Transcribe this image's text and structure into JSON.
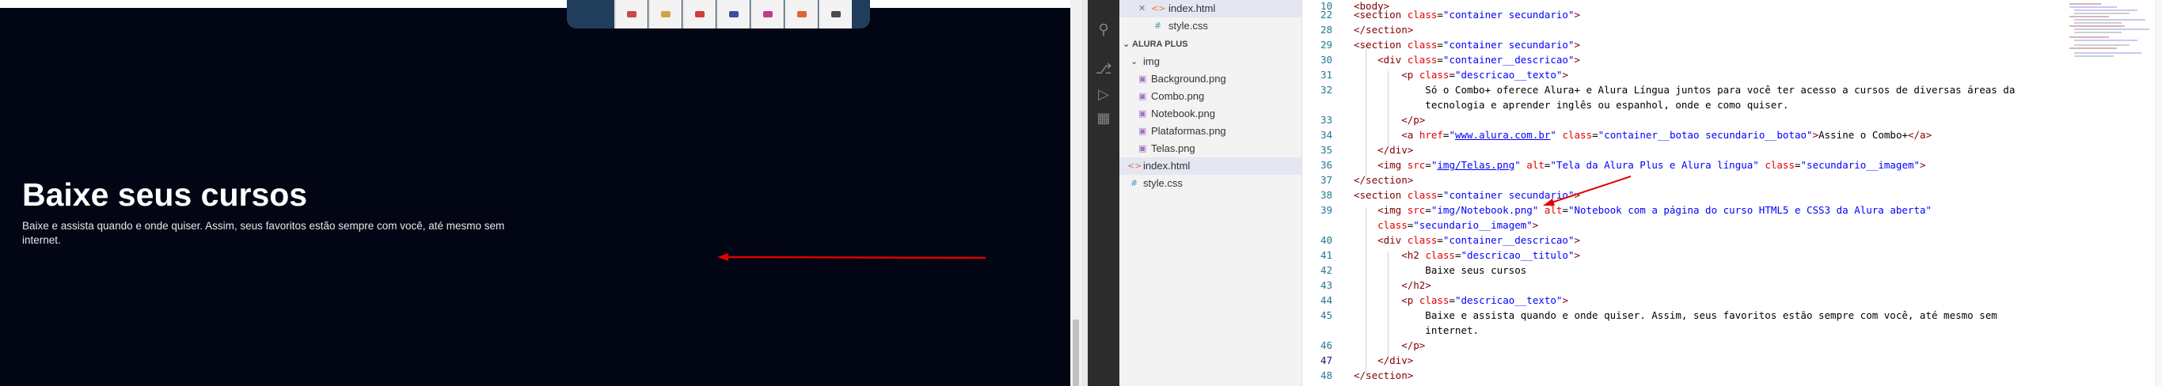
{
  "preview": {
    "heading": "Baixe seus cursos",
    "paragraph": "Baixe e assista quando e onde quiser. Assim, seus favoritos estão sempre com você, até mesmo sem internet."
  },
  "explorer": {
    "items": [
      {
        "label": "index.html",
        "icon": "html-file-icon"
      },
      {
        "label": "style.css",
        "icon": "css-file-icon"
      },
      {
        "label": "ALURA PLUS",
        "icon": "chevron-down-icon"
      },
      {
        "label": "img",
        "icon": "chevron-down-icon"
      },
      {
        "label": "Background.png",
        "icon": "image-file-icon"
      },
      {
        "label": "Combo.png",
        "icon": "image-file-icon"
      },
      {
        "label": "Notebook.png",
        "icon": "image-file-icon"
      },
      {
        "label": "Plataformas.png",
        "icon": "image-file-icon"
      },
      {
        "label": "Telas.png",
        "icon": "image-file-icon"
      },
      {
        "label": "index.html",
        "icon": "html-file-icon"
      },
      {
        "label": "style.css",
        "icon": "css-file-icon"
      }
    ]
  },
  "editor": {
    "line_numbers": [
      "10",
      "22",
      "28",
      "29",
      "30",
      "31",
      "32",
      "",
      "33",
      "34",
      "35",
      "36",
      "37",
      "38",
      "39",
      "",
      "40",
      "41",
      "42",
      "43",
      "44",
      "45",
      "",
      "46",
      "47",
      "48"
    ],
    "colors": {
      "tag": "#800000",
      "attr": "#e50000",
      "string": "#0000ff",
      "line_number": "#237893"
    }
  }
}
